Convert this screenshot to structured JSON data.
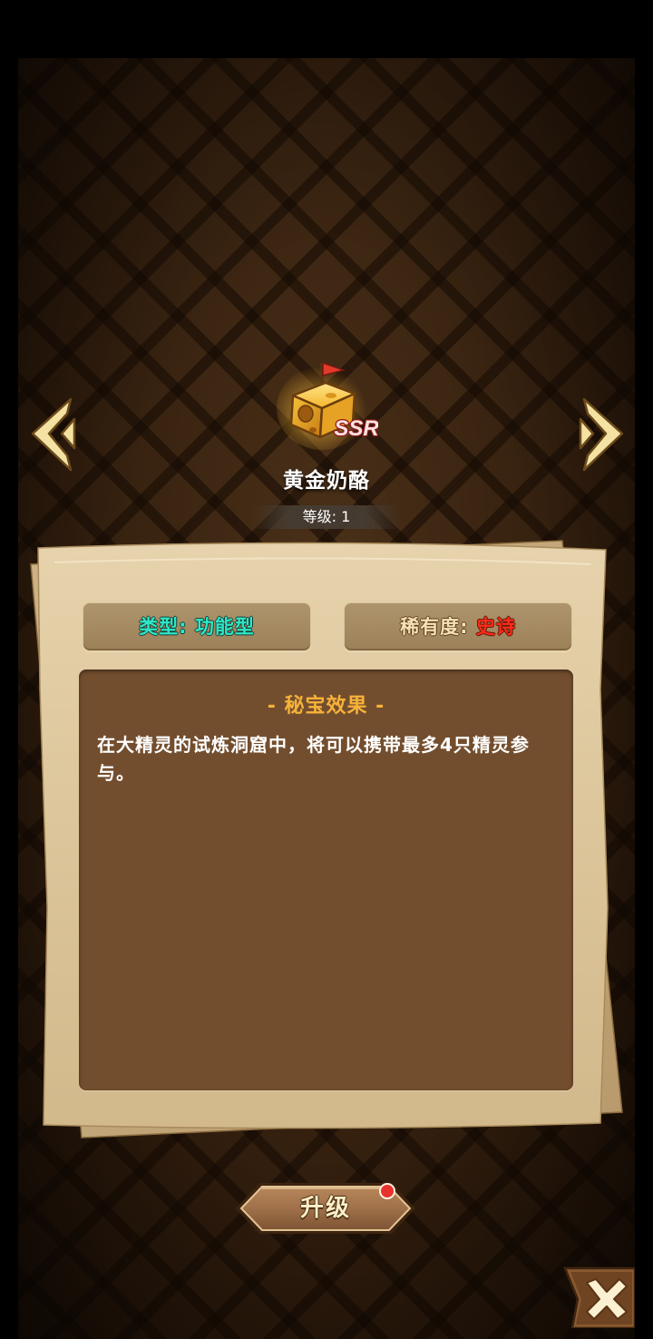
{
  "treasure": {
    "name": "黄金奶酪",
    "rarity_badge": "SSR",
    "level_text": "等级: 1"
  },
  "attributes": {
    "type_label": "类型: ",
    "type_value": "功能型",
    "rarity_label": "稀有度: ",
    "rarity_value": "史诗"
  },
  "effect": {
    "title": "- 秘宝效果 -",
    "description": "在大精灵的试炼洞窟中，将可以携带最多4只精灵参与。"
  },
  "buttons": {
    "upgrade_label": "升级",
    "upgrade_has_notification": true,
    "prev_icon": "chevron-left-icon",
    "next_icon": "chevron-right-icon",
    "close_icon": "close-icon"
  },
  "colors": {
    "type_value": "#2ee7c6",
    "rarity_value": "#ff2a18",
    "effect_title": "#f6b23a",
    "notification_dot": "#e8322c"
  }
}
